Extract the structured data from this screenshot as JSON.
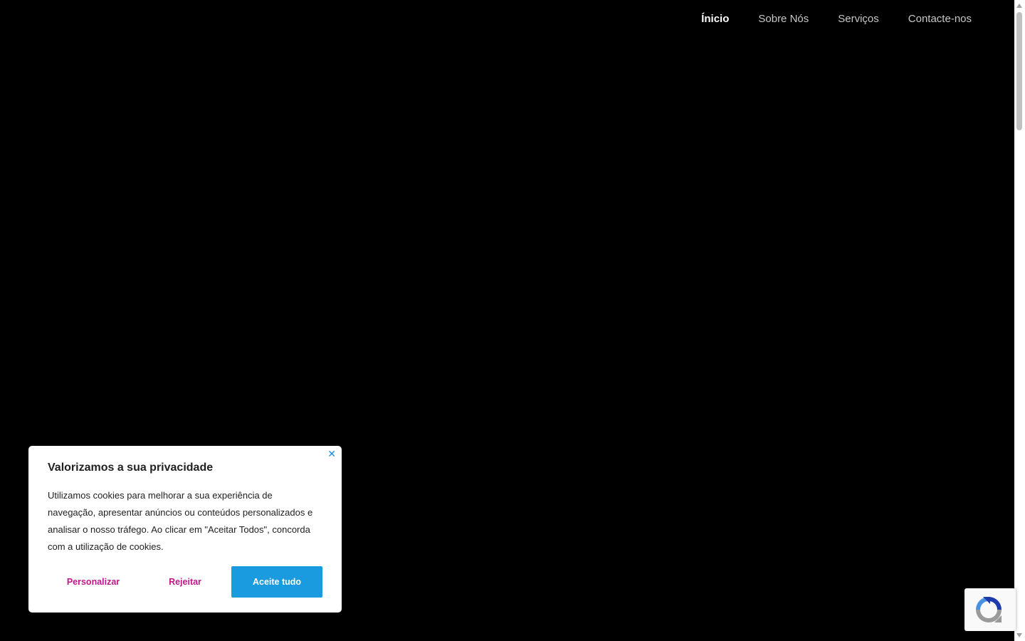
{
  "nav": {
    "items": [
      {
        "label": "Ínicio",
        "active": true
      },
      {
        "label": "Sobre Nós",
        "active": false
      },
      {
        "label": "Serviços",
        "active": false
      },
      {
        "label": "Contacte-nos",
        "active": false
      }
    ]
  },
  "cookie_banner": {
    "close_icon": "close-icon",
    "title": "Valorizamos a sua privacidade",
    "body": "Utilizamos cookies para melhorar a sua experiência de navegação, apresentar anúncios ou conteúdos personalizados e analisar o nosso tráfego. Ao clicar em \"Aceitar Todos\", concorda com a utilização de cookies.",
    "customize_label": "Personalizar",
    "reject_label": "Rejeitar",
    "accept_label": "Aceite tudo",
    "colors": {
      "accent": "#1a9be0",
      "link": "#c0168c"
    }
  },
  "recaptcha": {
    "icon": "recaptcha-icon"
  }
}
